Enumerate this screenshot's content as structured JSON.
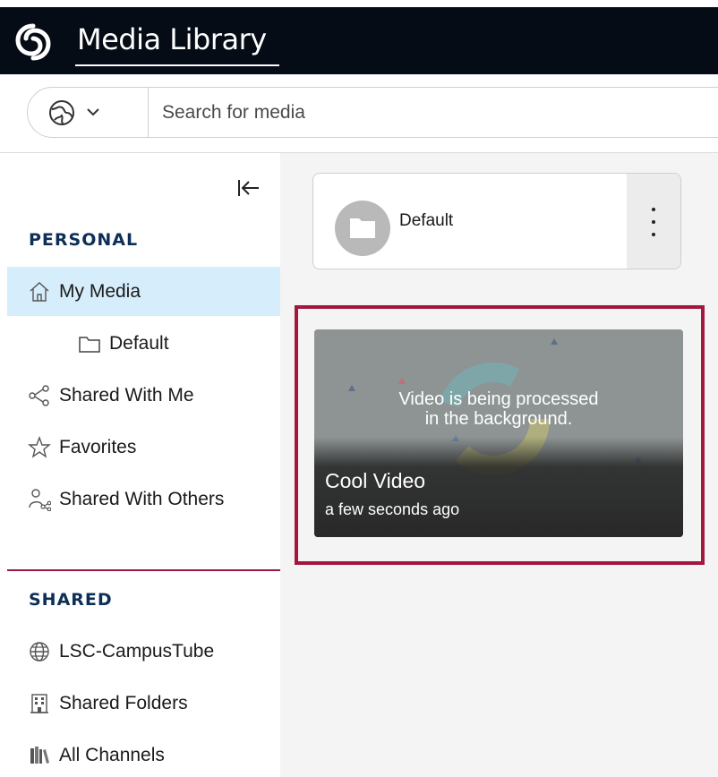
{
  "header": {
    "app_title": "Media Library",
    "logo_icon": "swirl-logo-icon",
    "background_color": "#050c16"
  },
  "search": {
    "scope_icon": "globe-icon",
    "placeholder": "Search for media",
    "value": ""
  },
  "sidebar": {
    "collapse_icon": "collapse-left-icon",
    "personal_title": "PERSONAL",
    "personal_items": [
      {
        "label": "My Media",
        "icon": "home-icon",
        "active": true
      },
      {
        "label": "Default",
        "icon": "folder-icon",
        "sub": true
      },
      {
        "label": "Shared With Me",
        "icon": "share-icon"
      },
      {
        "label": "Favorites",
        "icon": "star-icon"
      },
      {
        "label": "Shared With Others",
        "icon": "people-share-icon"
      }
    ],
    "shared_title": "SHARED",
    "shared_items": [
      {
        "label": "LSC-CampusTube",
        "icon": "globe-icon"
      },
      {
        "label": "Shared Folders",
        "icon": "building-icon"
      },
      {
        "label": "All Channels",
        "icon": "library-icon"
      }
    ],
    "accent_color": "#0d2f57",
    "active_bg": "#d6eefb",
    "divider_color": "#9a1b3f"
  },
  "main": {
    "folder": {
      "name": "Default",
      "icon": "folder-icon",
      "menu_icon": "kebab-menu-icon"
    },
    "video": {
      "status": "Video is being processed\nin the background.",
      "status_line1": "Video is being processed",
      "status_line2": "in the background.",
      "title": "Cool Video",
      "time": "a few seconds ago"
    },
    "highlight_color": "#a3173e"
  }
}
